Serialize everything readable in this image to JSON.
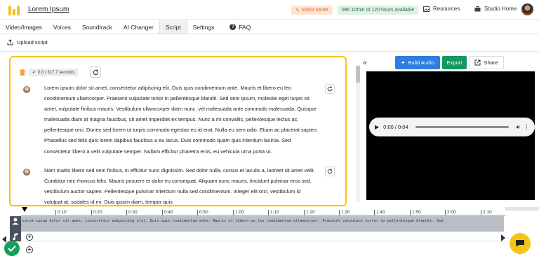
{
  "header": {
    "app_title": "Lorem Ipsum",
    "editor_mode": "Editor Mode",
    "hours_available": "99h 10min of 120 hours available",
    "resources": "Resources",
    "studio_home": "Studio Home"
  },
  "tabs": [
    {
      "label": "Video/Images"
    },
    {
      "label": "Voices"
    },
    {
      "label": "Soundtrack"
    },
    {
      "label": "AI Changer"
    },
    {
      "label": "Script",
      "active": true
    },
    {
      "label": "Settings"
    },
    {
      "label": "FAQ"
    }
  ],
  "toolbar": {
    "upload_script": "Upload script"
  },
  "script": {
    "progress": "0.0 / 317.7 seconds",
    "paragraphs": [
      "Lorem ipsum dolor sit amet, consectetur adipiscing elit. Duis quis condimentum ante. Mauris et libero eu leo condimentum ullamcorper. Praesent vulputate tortor in pellentesque blandit. Sed sem ipsum, molestie eget turpis sit amet, vulputate finibus mauris. Vestibulum ullamcorper diam nunc, vel malesuada ante commodo malesuada. Quisque malesuada diam at magna faucibus, sit amet imperdiet ex tempus. Nunc a mi convallis, pellentesque lectus ac, pellentesque orci. Donec sed lorem ut turpis commodo egestas eu id erat. Nulla eu sem odio. Etiam ac placerat sapien. Phasellus sed felis quis lorem dapibus faucibus a eu lacus. Duis commodo quam quis interdum lacinia. Sed consectetur libero a velit vulputate semper. Nullam efficitur pharetra eros, eu vehicula urna porta ut.",
      "Nam mattis libero sed sem finibus, in efficitur nunc dignissim. Sed dolor nulla, cursus et iaculis a, laoreet sit amet velit. Curabitur nec rhoncus felis. Mauris posuere et dolor eu consequat. Aliquam nunc mauris, tincidunt pulvinar eros sed, vestibulum auctor sapien. Pellentesque pulvinar interdum nulla sed condimentum. Integer elit orci, vestibulum id volutpat at, sodales id mi. Duis ipsum diam, tempor quis"
    ]
  },
  "preview": {
    "build_audio": "Build Audio",
    "export": "Export",
    "share": "Share",
    "audio_time": "0:00 / 0:04"
  },
  "timeline": {
    "ticks": [
      "0:10",
      "0:20",
      "0:30",
      "0:40",
      "0:50",
      "1:00",
      "1:10",
      "1:20",
      "1:30",
      "1:40",
      "1:50",
      "2:00",
      "2:10"
    ],
    "track_text": "Lorem ipsum dolor sit amet, consectetur adipiscing elit. Duis quis condimentum ante. Mauris et libero eu leo condimentum ullamcorper. Praesent vulputate tortor in pellentesque blandit. Sed"
  },
  "colors": {
    "accent_yellow": "#f5c415",
    "build_blue": "#2f7de1",
    "export_green": "#129a5c",
    "editor_mode_bg": "#fde3d4",
    "hours_bg": "#dff0e6"
  }
}
